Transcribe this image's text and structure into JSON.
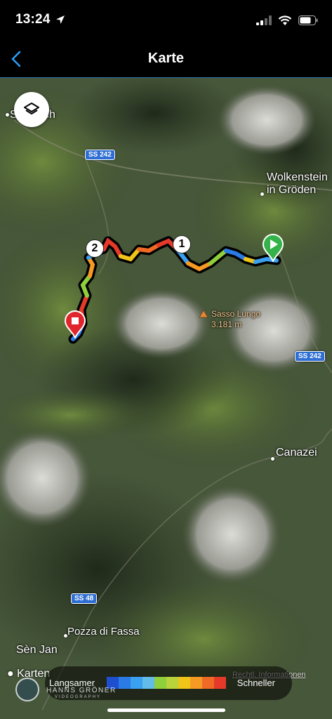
{
  "status_bar": {
    "time": "13:24",
    "icons": [
      "location-arrow-icon",
      "cellular-signal-icon",
      "wifi-icon",
      "battery-icon"
    ]
  },
  "nav": {
    "title": "Karte",
    "back_icon": "chevron-left-icon",
    "accent_color": "#2b9bf4"
  },
  "map": {
    "layers_icon": "layers-icon",
    "labels": {
      "st_ulrich": "St. Ulrich",
      "wolkenstein_line1": "Wolkenstein",
      "wolkenstein_line2": "in Gröden",
      "sasso_lungo": "Sasso Lungo",
      "sasso_lungo_height": "3.181 m",
      "canazei": "Canazei",
      "pozza": "Pozza di Fassa",
      "sen_jan": "Sèn Jan"
    },
    "roads": [
      "SS 242",
      "SS 242",
      "SS 48"
    ],
    "markers": {
      "lap_1": "1",
      "lap_2": "2",
      "start_icon": "play-flag-icon",
      "finish_icon": "stop-flag-icon"
    },
    "attribution": "Karten",
    "legal": "Rechtl. Informationen"
  },
  "legend": {
    "slower": "Langsamer",
    "faster": "Schneller",
    "colors": [
      "#1d4fcf",
      "#2a7be6",
      "#3aa0f0",
      "#62bce8",
      "#8fcf3c",
      "#b8d43a",
      "#f0c419",
      "#f59a23",
      "#ef6a25",
      "#e53a2a"
    ]
  },
  "watermark": {
    "name": "HANNS GRÖNER",
    "sub": "VIDEOGRAPHY"
  }
}
